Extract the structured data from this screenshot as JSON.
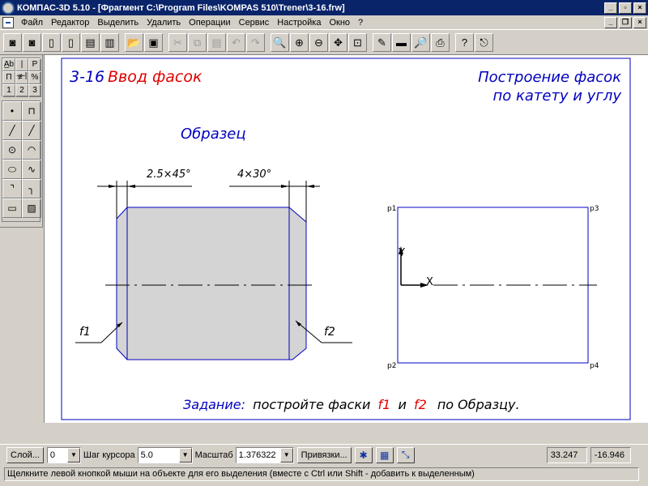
{
  "window": {
    "title": "КОМПАС-3D 5.10 - [Фрагмент C:\\Program Files\\KOMPAS 510\\Trener\\3-16.frw]",
    "min_glyph": "_",
    "max_glyph": "▫",
    "close_glyph": "×",
    "restore_glyph": "❐"
  },
  "menu": [
    "Файл",
    "Редактор",
    "Выделить",
    "Удалить",
    "Операции",
    "Сервис",
    "Настройка",
    "Окно",
    "?"
  ],
  "toolbar": {
    "buttons": [
      {
        "icon": "camera-icon",
        "glyph": "◙"
      },
      {
        "icon": "camera2-icon",
        "glyph": "◙"
      },
      {
        "icon": "new-doc-icon",
        "glyph": "▯"
      },
      {
        "icon": "new-sheet-icon",
        "glyph": "▯"
      },
      {
        "icon": "new-spec-icon",
        "glyph": "▤"
      },
      {
        "icon": "new-text-icon",
        "glyph": "▥"
      },
      {
        "icon": "open-icon",
        "glyph": "📂"
      },
      {
        "icon": "save-icon",
        "glyph": "▣"
      },
      {
        "icon": "cut-icon",
        "glyph": "✂"
      },
      {
        "icon": "copy-icon",
        "glyph": "⧉"
      },
      {
        "icon": "paste-icon",
        "glyph": "▤"
      },
      {
        "icon": "undo-icon",
        "glyph": "↶"
      },
      {
        "icon": "redo-icon",
        "glyph": "↷"
      },
      {
        "icon": "zoom-icon",
        "glyph": "🔍"
      },
      {
        "icon": "zoom-in-icon",
        "glyph": "⊕"
      },
      {
        "icon": "zoom-out-icon",
        "glyph": "⊖"
      },
      {
        "icon": "pan-icon",
        "glyph": "✥"
      },
      {
        "icon": "zoom-fit-icon",
        "glyph": "⊡"
      },
      {
        "icon": "brush-icon",
        "glyph": "✎"
      },
      {
        "icon": "rect-icon",
        "glyph": "▬"
      },
      {
        "icon": "print-preview-icon",
        "glyph": "🔎"
      },
      {
        "icon": "print-icon",
        "glyph": "⎙"
      },
      {
        "icon": "help-icon",
        "glyph": "?"
      },
      {
        "icon": "exit-icon",
        "glyph": "⎋"
      }
    ]
  },
  "left_panel": {
    "top": [
      "A̲b",
      "|—|",
      "P",
      "П",
      "≢",
      "%",
      "1",
      "2",
      "3"
    ],
    "tools": [
      {
        "icon": "point-icon",
        "glyph": "•"
      },
      {
        "icon": "aux-line-icon",
        "glyph": "⊓"
      },
      {
        "icon": "segment-icon",
        "glyph": "╱"
      },
      {
        "icon": "segment2-icon",
        "glyph": "╱"
      },
      {
        "icon": "circle-icon",
        "glyph": "⊙"
      },
      {
        "icon": "arc-icon",
        "glyph": "◠"
      },
      {
        "icon": "ellipse-icon",
        "glyph": "⬭"
      },
      {
        "icon": "bezier-icon",
        "glyph": "∿"
      },
      {
        "icon": "chamfer-icon",
        "glyph": "⌝"
      },
      {
        "icon": "fillet-icon",
        "glyph": "╮"
      },
      {
        "icon": "rectangle-icon",
        "glyph": "▭"
      },
      {
        "icon": "hatch-icon",
        "glyph": "▨"
      }
    ]
  },
  "drawing": {
    "lesson_number": "3-16",
    "lesson_title": "Ввод фасок",
    "heading_line1": "Построение фасок",
    "heading_line2": "по катету и углу",
    "sample_label": "Образец",
    "dim_left": "2.5×45°",
    "dim_right": "4×30°",
    "label_f1": "f1",
    "label_f2": "f2",
    "p1": "p1",
    "p2": "p2",
    "p3": "p3",
    "p4": "p4",
    "axis_y": "Y",
    "axis_x": "X",
    "task_word": "Задание:",
    "task_text": "постройте фаски",
    "task_f1": "f1",
    "task_and": "и",
    "task_f2": "f2",
    "task_end": "по Образцу."
  },
  "colors": {
    "blue": "#0000c0",
    "red": "#e00000",
    "fill": "#d4d4d4"
  },
  "status": {
    "layer_button": "Слой...",
    "layer_value": "0",
    "step_label": "Шаг курсора",
    "step_value": "5.0",
    "scale_label": "Масштаб",
    "scale_value": "1.376322",
    "snap_button": "Привязки...",
    "coord_x": "33.247",
    "coord_y": "-16.946",
    "hint": "Щелкните левой кнопкой мыши на объекте для его выделения (вместе с Ctrl или Shift - добавить к выделенным)"
  }
}
